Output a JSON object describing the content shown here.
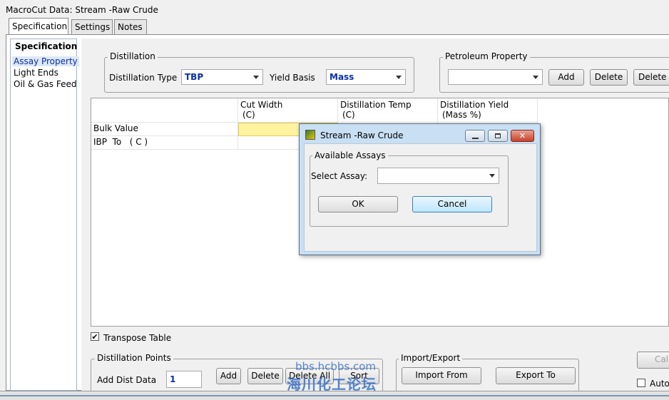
{
  "window": {
    "title": "MacroCut Data: Stream -Raw Crude"
  },
  "tabs": [
    "Specification",
    "Settings",
    "Notes"
  ],
  "sidebar": {
    "header": "Specification",
    "items": [
      "Assay Property",
      "Light Ends",
      "Oil & Gas Feed"
    ]
  },
  "distillation": {
    "group_label": "Distillation",
    "type_label": "Distillation Type",
    "type_value": "TBP",
    "yield_label": "Yield Basis",
    "yield_value": "Mass"
  },
  "petroleum": {
    "group_label": "Petroleum Property",
    "combo_value": "",
    "add": "Add",
    "delete": "Delete",
    "delete_all": "Delete A"
  },
  "grid": {
    "columns": [
      {
        "title": "Cut Width",
        "unit": "(C)"
      },
      {
        "title": "Distillation Temp",
        "unit": "(C)"
      },
      {
        "title": "Distillation Yield",
        "unit": "(Mass %)"
      }
    ],
    "rows": [
      "Bulk Value",
      "IBP  To   ( C )"
    ]
  },
  "dialog": {
    "title": "Stream -Raw Crude",
    "group_label": "Available Assays",
    "select_label": "Select Assay:",
    "select_value": "",
    "ok": "OK",
    "cancel": "Cancel"
  },
  "transpose": {
    "label": "Transpose Table",
    "checked": true
  },
  "dist_points": {
    "group_label": "Distillation Points",
    "add_label": "Add Dist Data",
    "add_value": "1",
    "add": "Add",
    "delete": "Delete",
    "delete_all": "Delete All",
    "sort": "Sort"
  },
  "import_export": {
    "group_label": "Import/Export",
    "import": "Import From",
    "export": "Export To"
  },
  "right_partial": {
    "calc": "Calc",
    "auto": "Auto"
  },
  "watermark": {
    "line1": "bbs.hcbbs.com",
    "line2": "海川化工论坛"
  }
}
